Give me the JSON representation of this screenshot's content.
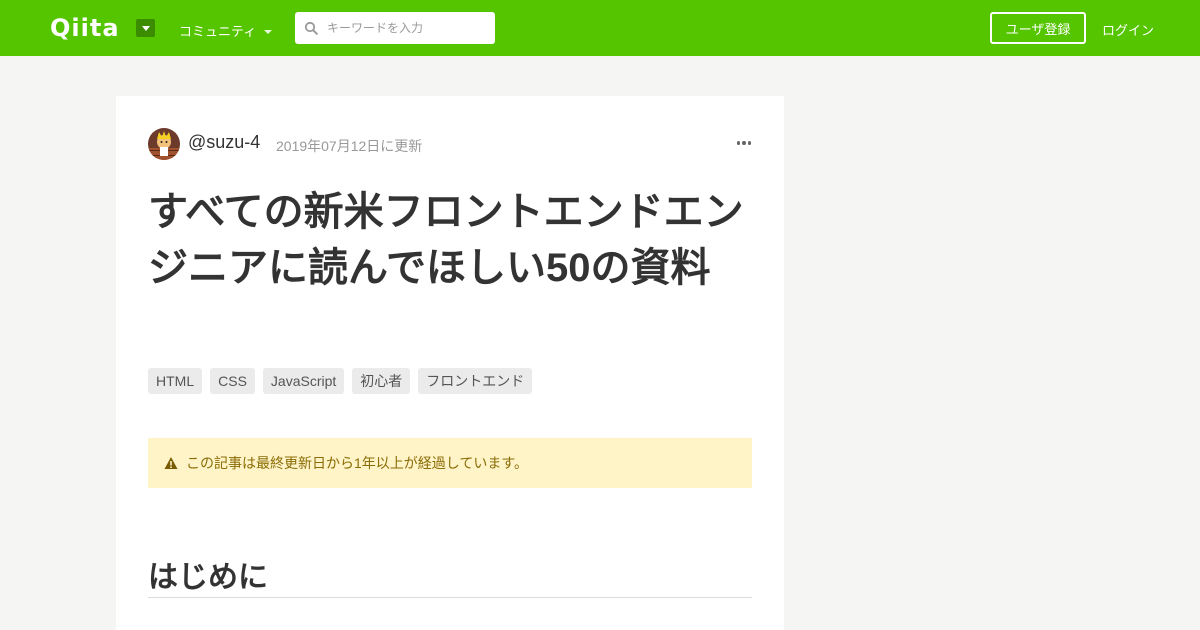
{
  "header": {
    "logo": "Qiita",
    "community_label": "コミュニティ",
    "search_placeholder": "キーワードを入力",
    "signup_label": "ユーザ登録",
    "login_label": "ログイン"
  },
  "article": {
    "author": "@suzu-4",
    "updated": "2019年07月12日に更新",
    "title": "すべての新米フロントエンドエンジニアに読んでほしい50の資料",
    "tags": [
      "HTML",
      "CSS",
      "JavaScript",
      "初心者",
      "フロントエンド"
    ],
    "notice": "この記事は最終更新日から1年以上が経過しています。",
    "section_heading": "はじめに"
  },
  "colors": {
    "brand": "#55c500",
    "notice_bg": "#fff3c8",
    "notice_text": "#8a6d05"
  }
}
